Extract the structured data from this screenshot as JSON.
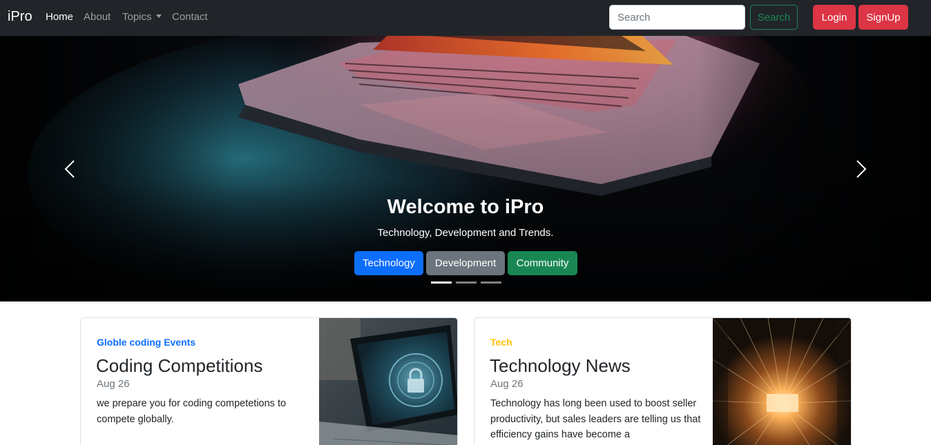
{
  "navbar": {
    "brand": "iPro",
    "links": [
      "Home",
      "About",
      "Topics",
      "Contact"
    ],
    "search_placeholder": "Search",
    "search_button": "Search",
    "login_button": "Login",
    "signup_button": "SignUp"
  },
  "carousel": {
    "title": "Welcome to iPro",
    "subtitle": "Technology, Development and Trends.",
    "buttons": [
      "Technology",
      "Development",
      "Community"
    ],
    "active_slide": 1,
    "slide_count": 3
  },
  "cards": [
    {
      "category": "Globle coding Events",
      "title": "Coding Competitions",
      "date": "Aug 26",
      "text": "we prepare you for coding competetions to compete globally."
    },
    {
      "category": "Tech",
      "title": "Technology News",
      "date": "Aug 26",
      "text": "Technology has long been used to boost seller productivity, but sales leaders are telling us that efficiency gains have become a"
    }
  ],
  "colors": {
    "primary": "#0d6efd",
    "secondary": "#6c757d",
    "success": "#198754",
    "danger": "#dc3545",
    "warning": "#ffc107",
    "navbar": "#212529"
  }
}
